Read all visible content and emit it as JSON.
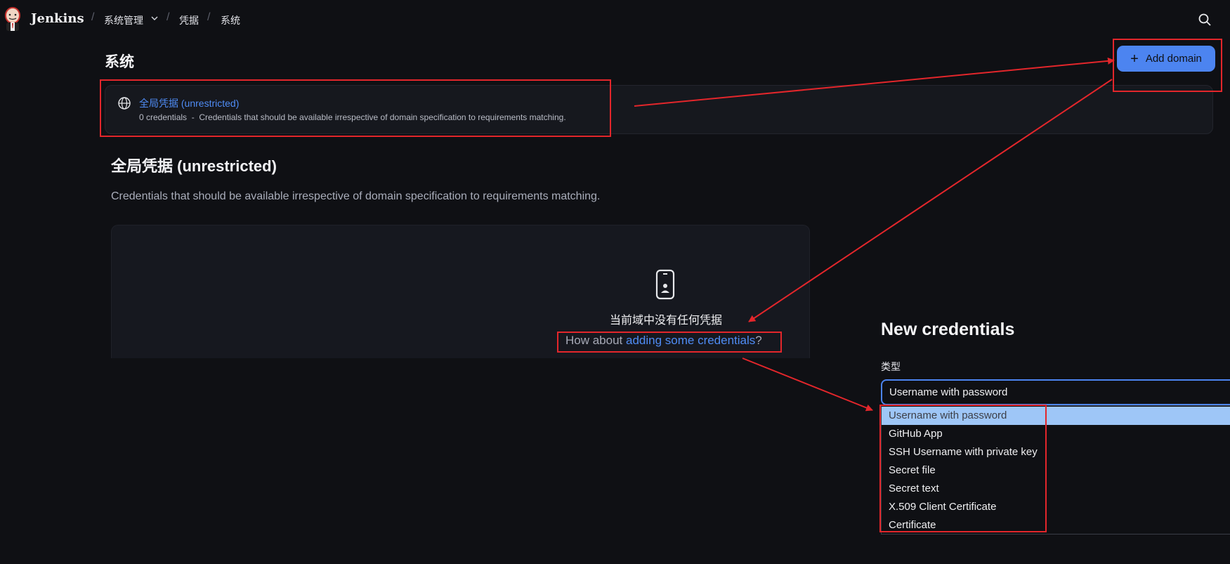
{
  "header": {
    "brand": "Jenkins",
    "breadcrumbs": [
      "系统管理",
      "凭据",
      "系统"
    ],
    "separator": "/"
  },
  "page": {
    "title": "系统",
    "add_domain_label": "Add domain",
    "add_domain_icon": "plus-icon"
  },
  "domain_card": {
    "link": "全局凭据 (unrestricted)",
    "description": "0 credentials  -  Credentials that should be available irrespective of domain specification to requirements matching.",
    "icon": "globe-icon"
  },
  "section": {
    "title": "全局凭据 (unrestricted)",
    "description": "Credentials that should be available irrespective of domain specification to requirements matching."
  },
  "empty_state": {
    "icon": "phone-user-icon",
    "message": "当前域中没有任何凭据",
    "prompt_prefix": "How about ",
    "prompt_link": "adding some credentials",
    "prompt_suffix": "?"
  },
  "new_credentials": {
    "title": "New credentials",
    "type_label": "类型",
    "selected_value": "Username with password",
    "options": [
      "Username with password",
      "GitHub App",
      "SSH Username with private key",
      "Secret file",
      "Secret text",
      "X.509 Client Certificate",
      "Certificate"
    ],
    "highlighted_index": 0
  },
  "colors": {
    "background": "#0f1014",
    "accent": "#4c84f0",
    "link": "#4f8cf5",
    "annotation": "#e3262b",
    "option_highlight": "#9ec6f7"
  }
}
